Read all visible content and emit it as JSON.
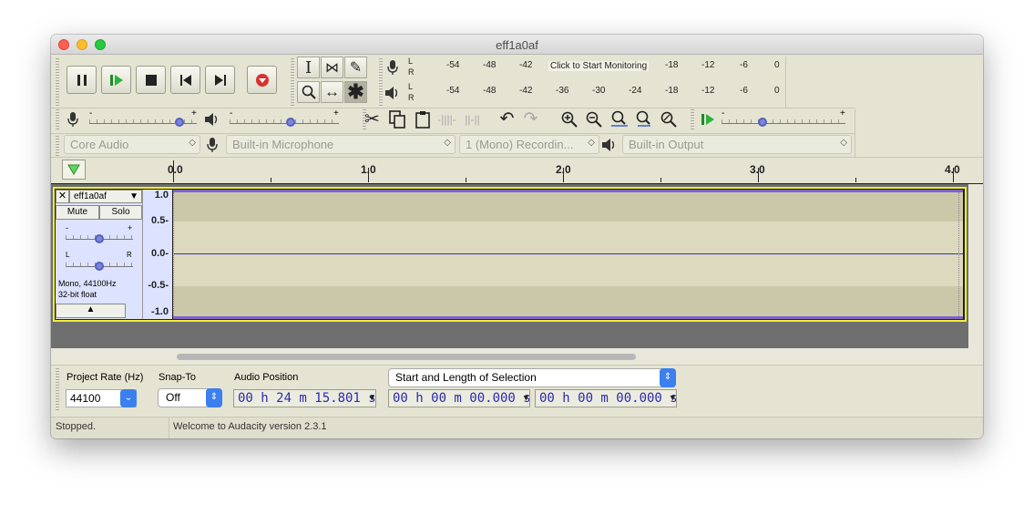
{
  "window": {
    "title": "eff1a0af"
  },
  "meters": {
    "record_ticks": [
      "-54",
      "-48",
      "-42",
      "-18",
      "-12",
      "-6",
      "0"
    ],
    "record_prompt": "Click to Start Monitoring",
    "play_ticks": [
      "-54",
      "-48",
      "-42",
      "-36",
      "-30",
      "-24",
      "-18",
      "-12",
      "-6",
      "0"
    ],
    "L": "L",
    "R": "R"
  },
  "mixer": {
    "minus": "-",
    "plus": "+"
  },
  "devices": {
    "host": "Core Audio",
    "input": "Built-in Microphone",
    "channels": "1 (Mono) Recordin...",
    "output": "Built-in Output"
  },
  "ruler": {
    "labels": [
      "0.0",
      "1.0",
      "2.0",
      "3.0",
      "4.0"
    ]
  },
  "track": {
    "name": "eff1a0af",
    "mute": "Mute",
    "solo": "Solo",
    "gain_minus": "-",
    "gain_plus": "+",
    "pan_left": "L",
    "pan_right": "R",
    "info_line1": "Mono, 44100Hz",
    "info_line2": "32-bit float",
    "y_ticks": [
      "1.0",
      "0.5-",
      "0.0-",
      "-0.5-",
      "-1.0"
    ]
  },
  "selection_bar": {
    "project_rate_label": "Project Rate (Hz)",
    "project_rate_value": "44100",
    "snap_to_label": "Snap-To",
    "snap_to_value": "Off",
    "audio_position_label": "Audio Position",
    "audio_position_value": "00 h 24 m 15.801 s",
    "selection_mode": "Start and Length of Selection",
    "selection_start": "00 h 00 m 00.000 s",
    "selection_length": "00 h 00 m 00.000 s"
  },
  "status": {
    "state": "Stopped.",
    "message": "Welcome to Audacity version 2.3.1"
  },
  "colors": {
    "toolbar_bg": "#e5e4d2",
    "waveform_band_dark": "#cbc8aa",
    "waveform_band_light": "#ddd9be",
    "track_panel": "#dde3ff",
    "selection_outline": "#f3ee2e",
    "accent_blue": "#3c7fee"
  }
}
